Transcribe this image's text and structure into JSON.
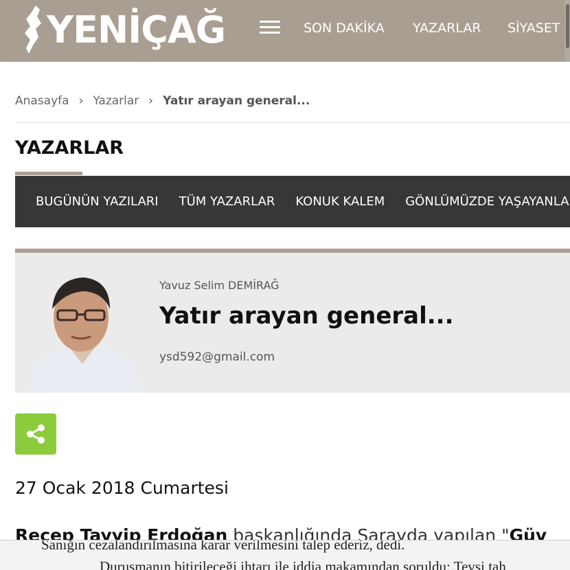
{
  "header": {
    "logo_text": "YENİÇAĞ",
    "nav": [
      "SON DAKİKA",
      "YAZARLAR",
      "SİYASET"
    ],
    "bg_color": "#a89f92"
  },
  "breadcrumb": {
    "home": "Anasayfa",
    "section": "Yazarlar",
    "current": "Yatır arayan general..."
  },
  "section_title": "YAZARLAR",
  "tabs": [
    "BUGÜNÜN YAZILARI",
    "TÜM YAZARLAR",
    "KONUK KALEM",
    "GÖNLÜMÜZDE YAŞAYANLAR"
  ],
  "article": {
    "author": "Yavuz Selim DEMİRAĞ",
    "title": "Yatır arayan general...",
    "email": "ysd592@gmail.com",
    "date": "27 Ocak 2018 Cumartesi",
    "intro_bold": "Recep Tayyip Erdoğan",
    "intro_rest": " başkanlığında Sarayda yapılan \"",
    "intro_bold2": "Güv"
  },
  "share": {
    "icon": "share-icon",
    "color": "#8ccc3c"
  },
  "scan": {
    "line1": "Sanığın cezalandırılmasına karar verilmesini talep ederiz, dedi.",
    "line2": "Duruşmanın bitirileceği ihtarı ile iddia makamından soruldu: Tevsi tah"
  }
}
